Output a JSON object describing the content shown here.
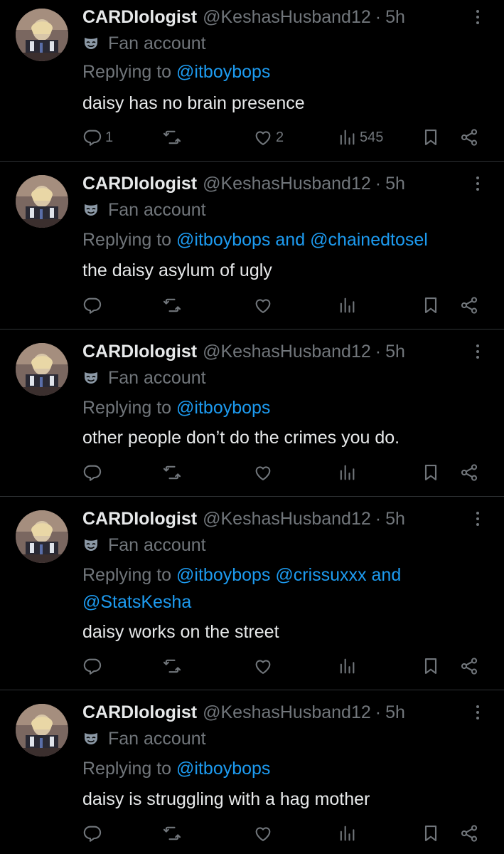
{
  "tweets": [
    {
      "name": "CARDIologist",
      "handle": "@KeshasHusband12",
      "dot": "·",
      "time": "5h",
      "label": "Fan account",
      "reply_prefix": "Replying to",
      "mentions": [
        "@itboybops"
      ],
      "text": "daisy has no brain presence",
      "counts": {
        "replies": "1",
        "retweets": "",
        "likes": "2",
        "views": "545"
      }
    },
    {
      "name": "CARDIologist",
      "handle": "@KeshasHusband12",
      "dot": "·",
      "time": "5h",
      "label": "Fan account",
      "reply_prefix": "Replying to",
      "mentions": [
        "@itboybops",
        "and",
        "@chainedtosel"
      ],
      "text": "the daisy asylum of ugly",
      "counts": {
        "replies": "",
        "retweets": "",
        "likes": "",
        "views": ""
      }
    },
    {
      "name": "CARDIologist",
      "handle": "@KeshasHusband12",
      "dot": "·",
      "time": "5h",
      "label": "Fan account",
      "reply_prefix": "Replying to",
      "mentions": [
        "@itboybops"
      ],
      "text": "other people don’t do the crimes you do.",
      "counts": {
        "replies": "",
        "retweets": "",
        "likes": "",
        "views": ""
      }
    },
    {
      "name": "CARDIologist",
      "handle": "@KeshasHusband12",
      "dot": "·",
      "time": "5h",
      "label": "Fan account",
      "reply_prefix": "Replying to",
      "mentions": [
        "@itboybops",
        "@crissuxxx",
        "and",
        "@StatsKesha"
      ],
      "text": "daisy works on the street",
      "counts": {
        "replies": "",
        "retweets": "",
        "likes": "",
        "views": ""
      }
    },
    {
      "name": "CARDIologist",
      "handle": "@KeshasHusband12",
      "dot": "·",
      "time": "5h",
      "label": "Fan account",
      "reply_prefix": "Replying to",
      "mentions": [
        "@itboybops"
      ],
      "text": "daisy is struggling with a hag mother",
      "counts": {
        "replies": "",
        "retweets": "",
        "likes": "",
        "views": ""
      }
    }
  ],
  "icons": [
    "more-options-icon",
    "theater-mask-icon",
    "reply-icon",
    "retweet-icon",
    "like-icon",
    "views-icon",
    "bookmark-icon",
    "share-icon"
  ],
  "colors": {
    "background": "#000000",
    "text": "#e7e9ea",
    "muted": "#71767b",
    "mention": "#1d9bf0",
    "divider": "#2f3336"
  }
}
